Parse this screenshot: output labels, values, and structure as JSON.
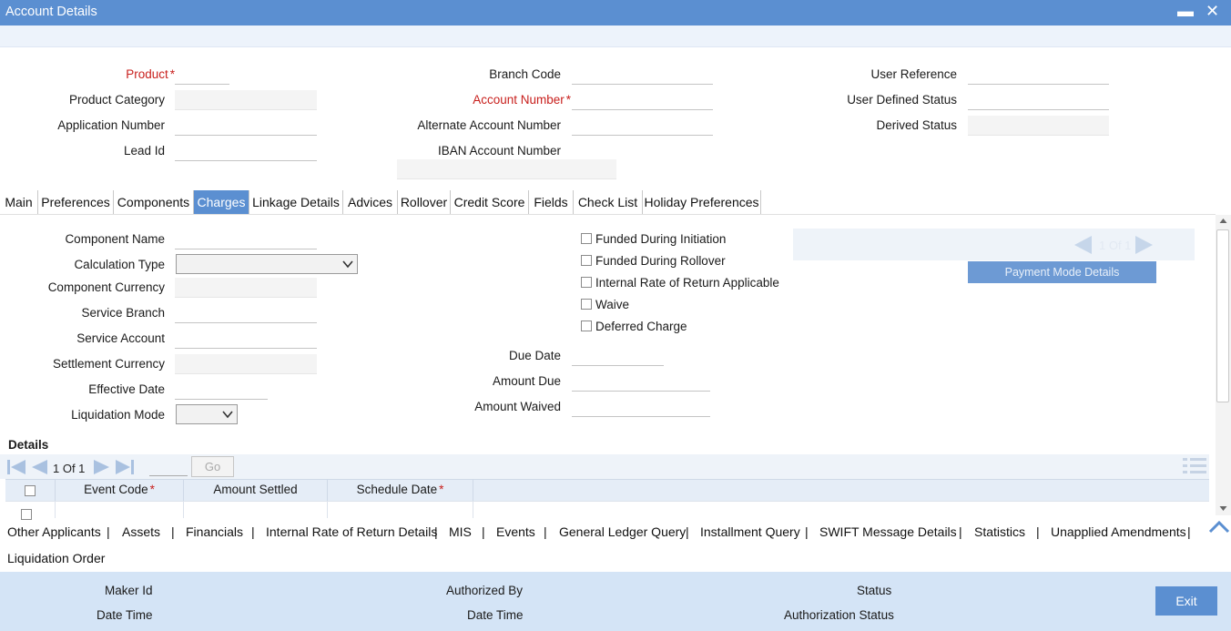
{
  "window": {
    "title": "Account Details",
    "minimize": "▬",
    "close": "✕"
  },
  "header": {
    "product": "Product",
    "product_category": "Product Category",
    "application_number": "Application Number",
    "lead_id": "Lead Id",
    "branch_code": "Branch Code",
    "account_number": "Account Number",
    "alternate_account_number": "Alternate Account Number",
    "iban_account_number": "IBAN Account Number",
    "user_reference": "User Reference",
    "user_defined_status": "User Defined Status",
    "derived_status": "Derived Status",
    "required_mark": "*"
  },
  "tabs": [
    "Main",
    "Preferences",
    "Components",
    "Charges",
    "Linkage Details",
    "Advices",
    "Rollover",
    "Credit Score",
    "Fields",
    "Check List",
    "Holiday Preferences"
  ],
  "active_tab": "Charges",
  "charges": {
    "component_name": "Component Name",
    "calculation_type": "Calculation Type",
    "component_currency": "Component Currency",
    "service_branch": "Service Branch",
    "service_account": "Service Account",
    "settlement_currency": "Settlement Currency",
    "effective_date": "Effective Date",
    "liquidation_mode": "Liquidation Mode",
    "funded_during_initiation": "Funded During Initiation",
    "funded_during_rollover": "Funded During Rollover",
    "irr_applicable": "Internal Rate of Return Applicable",
    "waive": "Waive",
    "deferred_charge": "Deferred Charge",
    "due_date": "Due Date",
    "amount_due": "Amount Due",
    "amount_waived": "Amount Waived",
    "pm_page": "1 Of 1",
    "payment_mode_details": "Payment Mode Details"
  },
  "details": {
    "title": "Details",
    "page_text": "1 Of 1",
    "go": "Go",
    "columns": [
      "Event Code",
      "Amount Settled",
      "Schedule Date"
    ],
    "required_mark": "*"
  },
  "links": [
    "Other Applicants",
    "Assets",
    "Financials",
    "Internal Rate of Return Details",
    "MIS",
    "Events",
    "General Ledger Query",
    "Installment Query",
    "SWIFT Message Details",
    "Statistics",
    "Unapplied Amendments",
    "Liquidation Order"
  ],
  "link_separator": "|",
  "footer": {
    "maker_id": "Maker Id",
    "date_time_1": "Date Time",
    "authorized_by": "Authorized By",
    "date_time_2": "Date Time",
    "status": "Status",
    "authorization_status": "Authorization Status",
    "exit": "Exit"
  },
  "colors": {
    "accent": "#5b8fd1",
    "required": "#c8201d",
    "footer": "#d4e4f6"
  }
}
